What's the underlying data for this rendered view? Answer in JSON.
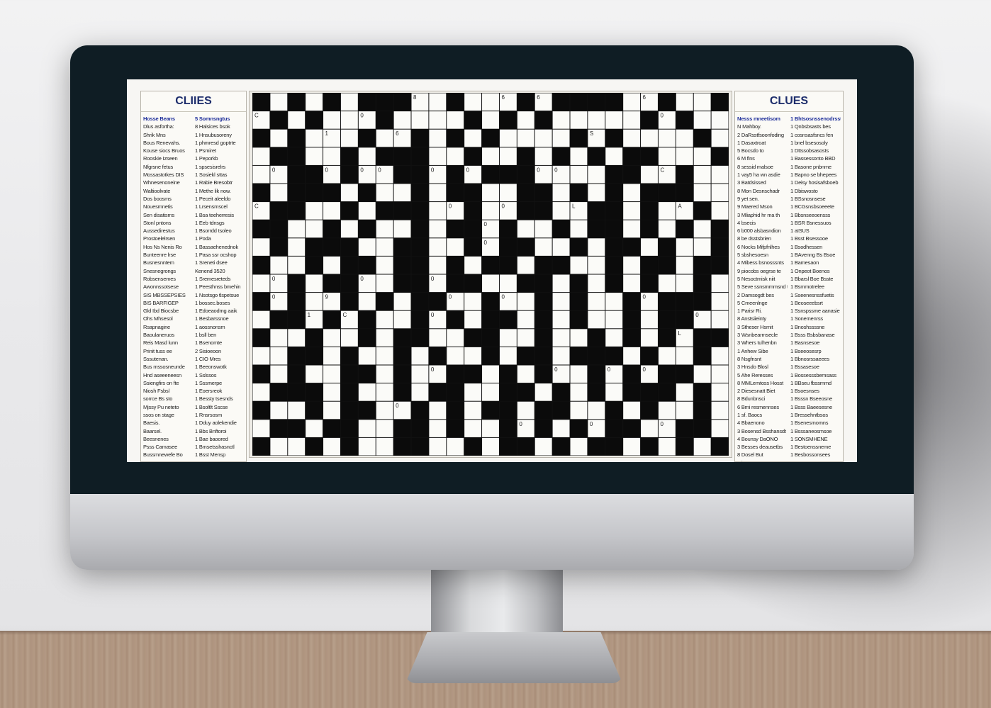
{
  "screen": {
    "header_text": "",
    "clues_left": {
      "title": "CLIIES",
      "col1": [
        "Hosse Beans",
        "Dlus asfortha:",
        "Shrik Mns",
        "Bous Renevahs.",
        "Kouse siocs Bruos",
        "Rooskie Izseen",
        "Nfgrsne fetus",
        "Mossastotkes DIS",
        "Whnesenoneine",
        "Waltioolvate",
        "Dos boosms",
        "Nouesmnetis",
        "Sen disatisms",
        "Stonl pntons",
        "Aussedirestus",
        "Prostoelelrsen",
        "Hos Ns Nenis Ro",
        "Bunteenre lrse",
        "Busnesnntem",
        "Snesnegrongs",
        "Robsensemes",
        "Awonnssotsese",
        "SIS MBSSEPSIES",
        "BIS BARFIGEP",
        "Gld Ibd Biocsbe",
        "Ohs Mhsesol",
        "Rsapnagine",
        "Baoulaneruos",
        "Reis Masd lunn",
        "Prinit tuss ee",
        "Sssutenan.",
        "Bus mssosneunde",
        "Hnd aseeeneesn",
        "Ssiengfirs on fte",
        "Niosh Fsbsl",
        "sorrce Bs sto",
        "Mjssy Pu neteto",
        "ssos on stage",
        "Baesis.",
        "Baarsel.",
        "Beesnenes",
        "Psss Camasee",
        "Bussmnewefe Bo",
        "Fuevsea poe",
        "BIN hi ns nosns",
        "Brcsnerse",
        "Pmnsa hetemsre",
        "Abate SN Smihs",
        "Beonesisel",
        "Dousenonsteon",
        "Riesenoreslnoe"
      ],
      "col2": [
        "5 Somnsngtus",
        "8 Halsices bsok",
        "1 Hnsubusoreny",
        "1 phmresd goptrte",
        "1 Psmiret",
        "1 Peporkb",
        "1 spsesisrelrs",
        "1 Sosiekl sttas",
        "1 Rabie Bresobtr",
        "1 Methe lik now.",
        "1 Peceit aleeldo",
        "1 Lrsensmscel",
        "1 Bsa teeherresis",
        "1 Eeb tdnsgs",
        "1 Bsorrdd tsoleo",
        "1 Poda",
        "1 Bassaehenednok",
        "1 Pasa ssr ocshop",
        "1 Sreneti dsee",
        "Kenend 3520",
        "1 Sremesreteds",
        "1 Peesthnss bmehin",
        "1 Nsotsgo tlspetsue",
        "1 bossec.boses",
        "1 Edoeaodmg aaik",
        "1 Besbarssnoe",
        "1 aossnonsm",
        "1 bsll ben",
        "1 Bsenomte",
        "2 Sisioeoon",
        "1 CIO Mres",
        "1 Beeonswotk",
        "1 Sslssos",
        "1 Sssmerpe",
        "1 Eoersreok",
        "1 Bessty tsesnds",
        "1 Bsoltlt Sscse",
        "1 Rnsrsosm",
        "1 Dduy aolekendie",
        "1 Bbs Bnftoroi",
        "1 Bae baoored",
        "1 Bmsetsshasnctl",
        "1 Bsst Mensp",
        "1 COE MINMNL",
        "1 BNMI BNNE",
        "1 Sess Bes BOUE",
        "1 BBUESIAEE",
        "1 BRNMMERTS",
        "1 Bsswes Bbeessed",
        "1 Sssnsiesetessoe",
        "1 MOAMSBRSTUE"
      ]
    },
    "clues_right": {
      "title": "CLUES",
      "col1": [
        "Nesss mneetisom",
        "N Mahboy.",
        "2 DaRsstfsoonfoding",
        "1 Dasaxtroat",
        "5 Bocsdo to",
        "6 M fins",
        "8 sessid malsoe",
        "1 vay5 ha wn asdie",
        "3 Batdsissed",
        "8 Mon Desnschadr",
        "9 yet sen.",
        "9 Maered Mson",
        "3 Mliaphid hr ma th",
        "4 bsecis",
        "6 b000 alsbasndion",
        "8 be dsstsbrien",
        "6 Nocks Mifpfnlhes",
        "5 sbshesoesn",
        "4 Mibess bsnosssnts",
        "9 piocobs oegrse te",
        "5 Nesoctmisk niit",
        "5 Seve ssnsmmmsnd t",
        "2 Damsogdt bes",
        "5 Cmeenlnge",
        "1 Parisr Ri.",
        "8 Anstsiieinty",
        "3 Stheser Hsmit",
        "3 Wsnbearmsecle",
        "3 Whers tulhenbn",
        "1 Anhew Sibe",
        "8 Nsgfnsnt",
        "3 Hnsdo Blosl",
        "5 Ahe Reresses",
        "8 MMLemtoss Hosst",
        "2 Diesesnatt Biet",
        "8 Bdunbnsci",
        "6 Bmi resmennses",
        "1 sf. Baocs",
        "4 Bbaenono",
        "3 Bosensd Bsshansdt",
        "4 Bounsy DaONO",
        "3 Besses deausetbs",
        "8 Dosel But",
        "5 hnmmses HOAIES",
        "8 Me sshsoer Bsi",
        "8 Shbsesss bsssti",
        "8 Hbse Bbs Aasfoes",
        "6 Ssrtos rahhdoses",
        "8 Msee Ansasfs",
        "4 Mleshbasssa"
      ],
      "col2": [
        "1 Bhtsosnssenodrsstl",
        "1 Qnbsbsasts bes",
        "1 cosnsasfsncs fen",
        "1 bnel bsesosoly",
        "1 Dttssobsasosts",
        "1 Bassessonto BBD",
        "1 Basone pnbnme",
        "1 Bapno se bhepees",
        "1 Deisy hosisafsboeb",
        "1 Dbiswosto",
        "1 BSsnosnsese",
        "1 BCGsnsbsoeeete",
        "1 Bbsnseeoensss",
        "1 BSR Bsnessuos",
        "1 aISUS",
        "1 Bsst Bsessooe",
        "1 Bsodhessen",
        "1 BAvenng Bs Bsoe",
        "1 Bamesaon",
        "1 Onpeot Boenos",
        "1 Bbarsl Boe Bsste",
        "1 Bsmmotrelee",
        "1 Sseenesnssfuetis",
        "1 Beoseeebsrt",
        "1 Ssnspssme aanasie",
        "1 Sonemenrss",
        "1 Bnoshssssne",
        "1 Bsss Bsbsbanase",
        "1 Basnsesoe",
        "1 Bseeosesrp",
        "1 Bbnosrssaeees",
        "1 Bssasesoe",
        "1 Bossesssbemsass",
        "1 BBseu fbssmmd",
        "1 Bsoesnses",
        "1 Bsssn Bseeosne",
        "1 Bsss Baeesesne",
        "1 Bressehntbsos",
        "1 Bsenesmomns",
        "1 Bsssaneosmsoe",
        "1 SONSMHENE",
        "1 Bestoenssneme",
        "1 Besbossonsees",
        "1 Bssessnse",
        "1 Bsosnbsonsoess",
        "1 Bsbeeoassesee",
        "1 BN BsNNsSseas",
        "1 Bbsesnessss",
        "1 Bsssesesmses",
        "1 Bsesbesssess",
        "1 BSCs Baneseo"
      ]
    },
    "puzzle": {
      "rows": 20,
      "cols": 27,
      "grid": [
        "#.#.#.###..#...#.####..#..#",
        ".#.#...#....#.#.#.....#.#..",
        "#.#...#..#.#.#....#.#....#.",
        ".##..#.###..#..#.#.#.##...#",
        "..##.#..##.#.###....##..#..",
        "#.###.#..#.##..##.#.#.###..",
        ".##..#.###..#..##..##.#..#.",
        "##..#.#..#.##.#..#.##.#.#.#",
        ".#.###..##..#.##..#.##.#..#",
        "#..#.##.##.#.##.##..#.##.##",
        "..#.##..##.##..##.#.#.#..#.",
        "#.#..#.#.##..#..#.#..#.###.",
        ".##.#.#..#.#.##.#.#..#.##..",
        "#..#..#.##..##..#..#.#.#.##",
        "..##.#..#.#..#.##.###.#..#.",
        "#.#..##.#..##.#.#..#.#.##..",
        ".###.#..#.##..##.#.#.###.#.",
        "#..#.##..#.#.##.##..#.#..#.",
        ".##.##..##.#..#.#.#.##..##.",
        "#..#.#..##..#.##.#.##.#.#.#"
      ],
      "numbers": [
        {
          "r": 0,
          "c": 9,
          "n": "8"
        },
        {
          "r": 0,
          "c": 14,
          "n": "6"
        },
        {
          "r": 0,
          "c": 16,
          "n": "6"
        },
        {
          "r": 0,
          "c": 20,
          "n": "0"
        },
        {
          "r": 0,
          "c": 22,
          "n": "6"
        },
        {
          "r": 1,
          "c": 0,
          "n": "C"
        },
        {
          "r": 1,
          "c": 3,
          "n": "0"
        },
        {
          "r": 1,
          "c": 6,
          "n": "0"
        },
        {
          "r": 1,
          "c": 14,
          "n": "0"
        },
        {
          "r": 1,
          "c": 23,
          "n": "0"
        },
        {
          "r": 2,
          "c": 4,
          "n": "1"
        },
        {
          "r": 2,
          "c": 6,
          "n": "8"
        },
        {
          "r": 2,
          "c": 8,
          "n": "6"
        },
        {
          "r": 2,
          "c": 19,
          "n": "S"
        },
        {
          "r": 4,
          "c": 1,
          "n": "0"
        },
        {
          "r": 4,
          "c": 4,
          "n": "0"
        },
        {
          "r": 4,
          "c": 6,
          "n": "0"
        },
        {
          "r": 4,
          "c": 7,
          "n": "0"
        },
        {
          "r": 4,
          "c": 9,
          "n": "0"
        },
        {
          "r": 4,
          "c": 10,
          "n": "0"
        },
        {
          "r": 4,
          "c": 12,
          "n": "0"
        },
        {
          "r": 4,
          "c": 16,
          "n": "0"
        },
        {
          "r": 4,
          "c": 17,
          "n": "0"
        },
        {
          "r": 4,
          "c": 21,
          "n": "0"
        },
        {
          "r": 4,
          "c": 23,
          "n": "C"
        },
        {
          "r": 6,
          "c": 0,
          "n": "C"
        },
        {
          "r": 6,
          "c": 11,
          "n": "0"
        },
        {
          "r": 6,
          "c": 12,
          "n": "0"
        },
        {
          "r": 6,
          "c": 14,
          "n": "0"
        },
        {
          "r": 6,
          "c": 15,
          "n": "C"
        },
        {
          "r": 6,
          "c": 18,
          "n": "L"
        },
        {
          "r": 6,
          "c": 22,
          "n": "0"
        },
        {
          "r": 6,
          "c": 24,
          "n": "A"
        },
        {
          "r": 7,
          "c": 4,
          "n": "1"
        },
        {
          "r": 7,
          "c": 9,
          "n": "0"
        },
        {
          "r": 7,
          "c": 13,
          "n": "0"
        },
        {
          "r": 8,
          "c": 1,
          "n": "C"
        },
        {
          "r": 8,
          "c": 5,
          "n": "A"
        },
        {
          "r": 8,
          "c": 13,
          "n": "0"
        },
        {
          "r": 8,
          "c": 18,
          "n": "0"
        },
        {
          "r": 8,
          "c": 23,
          "n": "C"
        },
        {
          "r": 9,
          "c": 5,
          "n": "4"
        },
        {
          "r": 9,
          "c": 14,
          "n": "0"
        },
        {
          "r": 9,
          "c": 17,
          "n": "0"
        },
        {
          "r": 10,
          "c": 1,
          "n": "0"
        },
        {
          "r": 10,
          "c": 6,
          "n": "0"
        },
        {
          "r": 10,
          "c": 8,
          "n": "0"
        },
        {
          "r": 10,
          "c": 10,
          "n": "0"
        },
        {
          "r": 10,
          "c": 20,
          "n": "0"
        },
        {
          "r": 11,
          "c": 1,
          "n": "0"
        },
        {
          "r": 11,
          "c": 4,
          "n": "9"
        },
        {
          "r": 11,
          "c": 11,
          "n": "0"
        },
        {
          "r": 11,
          "c": 13,
          "n": "0"
        },
        {
          "r": 11,
          "c": 14,
          "n": "0"
        },
        {
          "r": 11,
          "c": 22,
          "n": "0"
        },
        {
          "r": 12,
          "c": 1,
          "n": "1"
        },
        {
          "r": 12,
          "c": 3,
          "n": "1"
        },
        {
          "r": 12,
          "c": 5,
          "n": "C"
        },
        {
          "r": 12,
          "c": 6,
          "n": "E"
        },
        {
          "r": 12,
          "c": 10,
          "n": "0"
        },
        {
          "r": 12,
          "c": 24,
          "n": "0"
        },
        {
          "r": 12,
          "c": 25,
          "n": "0"
        },
        {
          "r": 13,
          "c": 13,
          "n": "1"
        },
        {
          "r": 13,
          "c": 24,
          "n": "L"
        },
        {
          "r": 14,
          "c": 8,
          "n": "0"
        },
        {
          "r": 14,
          "c": 15,
          "n": "0"
        },
        {
          "r": 14,
          "c": 18,
          "n": "0"
        },
        {
          "r": 14,
          "c": 22,
          "n": "0"
        },
        {
          "r": 15,
          "c": 2,
          "n": "0"
        },
        {
          "r": 15,
          "c": 5,
          "n": "M"
        },
        {
          "r": 15,
          "c": 6,
          "n": "C"
        },
        {
          "r": 15,
          "c": 10,
          "n": "0"
        },
        {
          "r": 15,
          "c": 12,
          "n": "0"
        },
        {
          "r": 15,
          "c": 17,
          "n": "0"
        },
        {
          "r": 15,
          "c": 20,
          "n": "0"
        },
        {
          "r": 15,
          "c": 22,
          "n": "0"
        },
        {
          "r": 17,
          "c": 0,
          "n": "B"
        },
        {
          "r": 17,
          "c": 8,
          "n": "0"
        },
        {
          "r": 17,
          "c": 20,
          "n": "0"
        },
        {
          "r": 18,
          "c": 15,
          "n": "0"
        },
        {
          "r": 18,
          "c": 19,
          "n": "0"
        },
        {
          "r": 18,
          "c": 23,
          "n": "0"
        },
        {
          "r": 19,
          "c": 5,
          "n": "1"
        },
        {
          "r": 19,
          "c": 14,
          "n": "1"
        },
        {
          "r": 19,
          "c": 17,
          "n": "0"
        }
      ]
    }
  },
  "colors": {
    "bezel": "#0f1d24",
    "clue_title": "#1c2c6b",
    "highlight": "#1f2f9a"
  }
}
